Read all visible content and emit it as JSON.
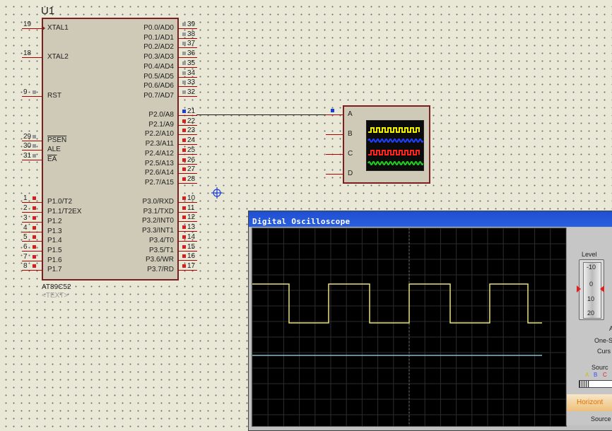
{
  "chip": {
    "ref": "U1",
    "part": "AT89C52",
    "text_placeholder": "<TEXT>",
    "left_pins": [
      {
        "num": "19",
        "name": "XTAL1"
      },
      {
        "num": "18",
        "name": "XTAL2"
      },
      {
        "num": "9",
        "name": "RST"
      },
      {
        "num": "29",
        "name": "PSEN"
      },
      {
        "num": "30",
        "name": "ALE"
      },
      {
        "num": "31",
        "name": "EA"
      },
      {
        "num": "1",
        "name": "P1.0/T2"
      },
      {
        "num": "2",
        "name": "P1.1/T2EX"
      },
      {
        "num": "3",
        "name": "P1.2"
      },
      {
        "num": "4",
        "name": "P1.3"
      },
      {
        "num": "5",
        "name": "P1.4"
      },
      {
        "num": "6",
        "name": "P1.5"
      },
      {
        "num": "7",
        "name": "P1.6"
      },
      {
        "num": "8",
        "name": "P1.7"
      }
    ],
    "right_pins": [
      {
        "num": "39",
        "name": "P0.0/AD0"
      },
      {
        "num": "38",
        "name": "P0.1/AD1"
      },
      {
        "num": "37",
        "name": "P0.2/AD2"
      },
      {
        "num": "36",
        "name": "P0.3/AD3"
      },
      {
        "num": "35",
        "name": "P0.4/AD4"
      },
      {
        "num": "34",
        "name": "P0.5/AD5"
      },
      {
        "num": "33",
        "name": "P0.6/AD6"
      },
      {
        "num": "32",
        "name": "P0.7/AD7"
      },
      {
        "num": "21",
        "name": "P2.0/A8"
      },
      {
        "num": "22",
        "name": "P2.1/A9"
      },
      {
        "num": "23",
        "name": "P2.2/A10"
      },
      {
        "num": "24",
        "name": "P2.3/A11"
      },
      {
        "num": "25",
        "name": "P2.4/A12"
      },
      {
        "num": "26",
        "name": "P2.5/A13"
      },
      {
        "num": "27",
        "name": "P2.6/A14"
      },
      {
        "num": "28",
        "name": "P2.7/A15"
      },
      {
        "num": "10",
        "name": "P3.0/RXD"
      },
      {
        "num": "11",
        "name": "P3.1/TXD"
      },
      {
        "num": "12",
        "name": "P3.2/INT0"
      },
      {
        "num": "13",
        "name": "P3.3/INT1"
      },
      {
        "num": "14",
        "name": "P3.4/T0"
      },
      {
        "num": "15",
        "name": "P3.5/T1"
      },
      {
        "num": "16",
        "name": "P3.6/WR"
      },
      {
        "num": "17",
        "name": "P3.7/RD"
      }
    ]
  },
  "scope_symbol": {
    "inputs": [
      "A",
      "B",
      "C",
      "D"
    ],
    "trace_colors": [
      "#f0f000",
      "#2040ff",
      "#ff2020",
      "#20d020"
    ]
  },
  "oscilloscope": {
    "title": "Digital Oscilloscope",
    "level_label": "Level",
    "level_ticks": [
      "-10",
      "0",
      "10",
      "20"
    ],
    "side_labels": [
      "A",
      "One-S",
      "Curs",
      "Sourc"
    ],
    "source_letters": [
      "A",
      "B",
      "C"
    ],
    "horizontal_label": "Horizont",
    "source_bottom": "Source",
    "channel_a_color": "#e8e080",
    "channel_b_color": "#90b8c8"
  }
}
